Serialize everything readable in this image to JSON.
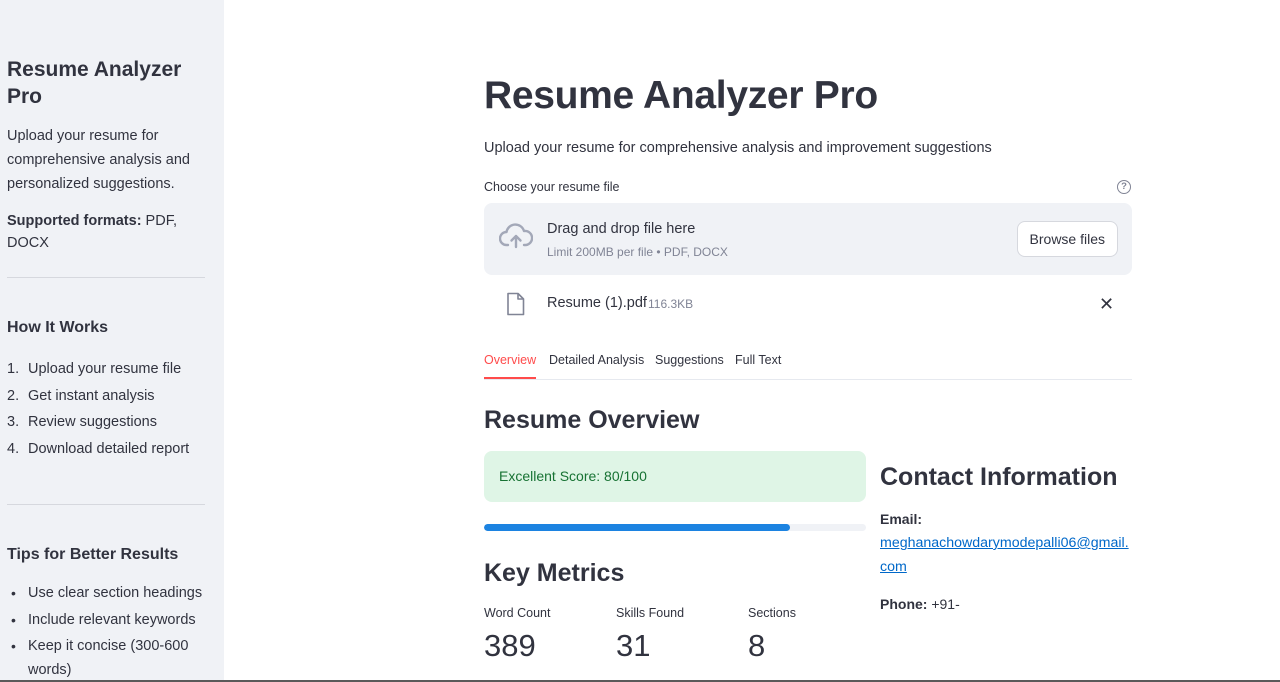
{
  "sidebar": {
    "title": "Resume Analyzer Pro",
    "description": "Upload your resume for comprehensive analysis and personalized suggestions.",
    "formats_label": "Supported formats:",
    "formats_value": " PDF, DOCX",
    "how_title": "How It Works",
    "steps": [
      {
        "num": "1.",
        "text": "Upload your resume file"
      },
      {
        "num": "2.",
        "text": "Get instant analysis"
      },
      {
        "num": "3.",
        "text": "Review suggestions"
      },
      {
        "num": "4.",
        "text": "Download detailed report"
      }
    ],
    "tips_title": "Tips for Better Results",
    "tips": [
      "Use clear section headings",
      "Include relevant keywords",
      "Keep it concise (300-600 words)"
    ]
  },
  "main": {
    "title": "Resume Analyzer Pro",
    "subtitle": "Upload your resume for comprehensive analysis and improvement suggestions",
    "uploader": {
      "label": "Choose your resume file",
      "help": "?",
      "drop_text": "Drag and drop file here",
      "limit_text": "Limit 200MB per file • PDF, DOCX",
      "browse_label": "Browse files"
    },
    "file": {
      "name": "Resume (1).pdf",
      "size": "116.3KB"
    },
    "tabs": [
      {
        "label": "Overview",
        "active": true
      },
      {
        "label": "Detailed Analysis",
        "active": false
      },
      {
        "label": "Suggestions",
        "active": false
      },
      {
        "label": "Full Text",
        "active": false
      }
    ],
    "overview_title": "Resume Overview",
    "score_text": "Excellent Score: 80/100",
    "score_progress_percent": 80,
    "metrics_title": "Key Metrics",
    "metrics": [
      {
        "label": "Word Count",
        "value": "389"
      },
      {
        "label": "Skills Found",
        "value": "31"
      },
      {
        "label": "Sections",
        "value": "8"
      }
    ],
    "contact": {
      "title": "Contact Information",
      "email_label": "Email:",
      "email_value": "meghanachowdarymodepalli06@gmail.com",
      "phone_label": "Phone:",
      "phone_value": " +91-"
    }
  },
  "colors": {
    "accent": "#ff4b4b",
    "progress": "#1c83e1",
    "success_bg": "#dff5e6",
    "success_text": "#177233",
    "link": "#0068c9",
    "sidebar_bg": "#f0f2f6"
  }
}
